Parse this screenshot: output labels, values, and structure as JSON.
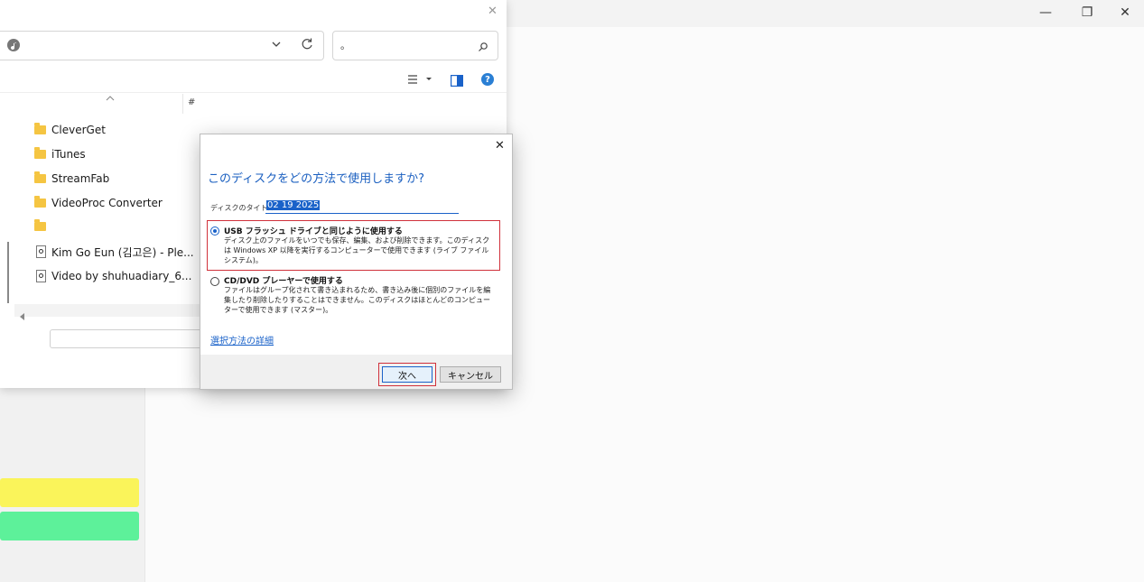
{
  "background_window": {
    "window_controls": {
      "minimize": "—",
      "restore": "❐",
      "close": "✕"
    },
    "colors": {
      "yellow_bar": "#faf45a",
      "green_bar": "#5df19a"
    }
  },
  "explorer": {
    "close_glyph": "✕",
    "address": {
      "value": ""
    },
    "search": {
      "value": "。"
    },
    "column_header": "#",
    "items": [
      {
        "label": "CleverGet",
        "icon": "folder-icon"
      },
      {
        "label": "iTunes",
        "icon": "folder-icon"
      },
      {
        "label": "StreamFab",
        "icon": "folder-icon"
      },
      {
        "label": "VideoProc Converter",
        "icon": "folder-icon"
      },
      {
        "label": "",
        "icon": "folder-icon"
      },
      {
        "label": "Kim Go Eun (김고은) - Ple...",
        "icon": "media-file-icon"
      },
      {
        "label": "Video by shuhuadiary_6...",
        "icon": "media-file-icon"
      }
    ],
    "help_glyph": "?"
  },
  "dialog": {
    "close_glyph": "✕",
    "title": "このディスクをどの方法で使用しますか?",
    "disc_title_label": "ディスクのタイトル:",
    "disc_title_value": "02 19 2025",
    "options": [
      {
        "title": "USB フラッシュ ドライブと同じように使用する",
        "description": "ディスク上のファイルをいつでも保存、編集、および削除できます。このディスクは Windows XP 以降を実行するコンピューターで使用できます (ライブ ファイル システム)。",
        "selected": true
      },
      {
        "title": "CD/DVD プレーヤーで使用する",
        "description": "ファイルはグループ化されて書き込まれるため、書き込み後に個別のファイルを編集したり削除したりすることはできません。このディスクはほとんどのコンピューターで使用できます (マスター)。",
        "selected": false
      }
    ],
    "help_link": "選択方法の詳細",
    "next_button": "次へ",
    "cancel_button": "キャンセル",
    "accent_color": "#1a62c9",
    "highlight_color": "#d0313b"
  }
}
